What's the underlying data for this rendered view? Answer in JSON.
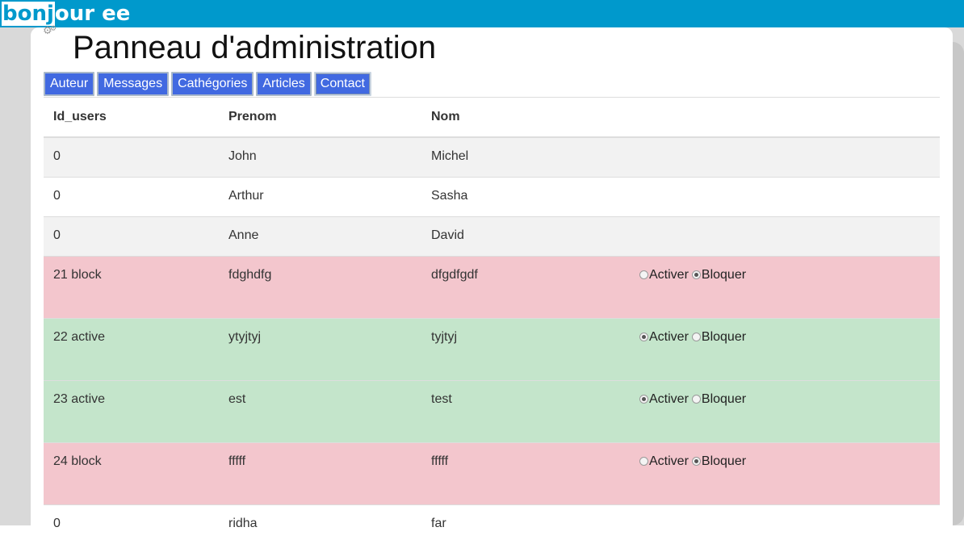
{
  "header": {
    "greeting_highlighted": "bonj",
    "greeting_rest": "our ee"
  },
  "page": {
    "title": "Panneau d'administration",
    "gear_icon": "gear-icon"
  },
  "colors": {
    "topbar": "#0099cc",
    "tab_bg": "#4169e1",
    "row_blocked": "#f3c6cd",
    "row_active": "#c4e5cb",
    "row_striped": "#f2f2f2"
  },
  "tabs": [
    {
      "label": "Auteur"
    },
    {
      "label": "Messages"
    },
    {
      "label": "Cathégories"
    },
    {
      "label": "Articles"
    },
    {
      "label": "Contact",
      "active": true
    }
  ],
  "table": {
    "headers": [
      "Id_users",
      "Prenom",
      "Nom",
      ""
    ],
    "rows": [
      {
        "id": "0",
        "prenom": "John",
        "nom": "Michel",
        "status": null
      },
      {
        "id": "0",
        "prenom": "Arthur",
        "nom": "Sasha",
        "status": null
      },
      {
        "id": "0",
        "prenom": "Anne",
        "nom": "David",
        "status": null
      },
      {
        "id": "21 block",
        "prenom": "fdghdfg",
        "nom": "dfgdfgdf",
        "status": "bloquer"
      },
      {
        "id": "22 active",
        "prenom": "ytyjtyj",
        "nom": "tyjtyj",
        "status": "activer"
      },
      {
        "id": "23 active",
        "prenom": "est",
        "nom": "test",
        "status": "activer"
      },
      {
        "id": "24 block",
        "prenom": "fffff",
        "nom": "fffff",
        "status": "bloquer"
      },
      {
        "id": "0",
        "prenom": "ridha",
        "nom": "far",
        "status": null
      }
    ],
    "radio_labels": {
      "activer": "Activer",
      "bloquer": "Bloquer"
    }
  }
}
